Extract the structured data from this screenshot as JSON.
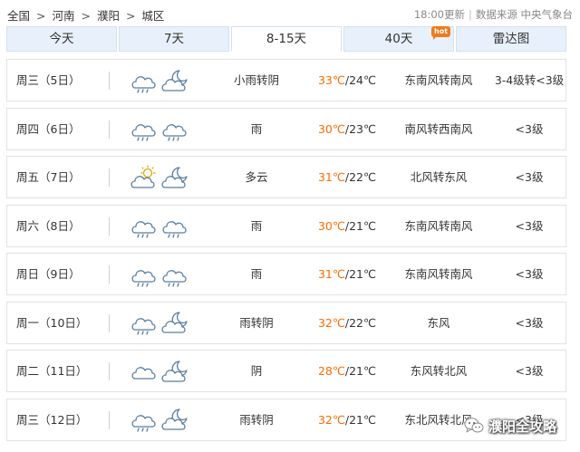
{
  "breadcrumb": {
    "items": [
      "全国",
      "河南",
      "濮阳",
      "城区"
    ],
    "separator": ">"
  },
  "update": {
    "time": "18:00更新",
    "source": "数据来源 中央气象台",
    "divider": "|"
  },
  "tabs": [
    {
      "label": "今天"
    },
    {
      "label": "7天"
    },
    {
      "label": "8-15天",
      "active": true
    },
    {
      "label": "40天",
      "badge": "hot"
    },
    {
      "label": "雷达图"
    }
  ],
  "temp_unit_sep": "/",
  "rows": [
    {
      "day": "周三（5日）",
      "icons": [
        "rain-cloud-icon",
        "moon-cloud-icon"
      ],
      "weather": "小雨转阴",
      "high": "33℃",
      "low": "24℃",
      "wind": "东南风转南风",
      "level": "3-4级转<3级"
    },
    {
      "day": "周四（6日）",
      "icons": [
        "rain-cloud-icon",
        "rain-cloud-icon"
      ],
      "weather": "雨",
      "high": "30℃",
      "low": "23℃",
      "wind": "南风转西南风",
      "level": "<3级"
    },
    {
      "day": "周五（7日）",
      "icons": [
        "sun-cloud-icon",
        "moon-cloud-icon"
      ],
      "weather": "多云",
      "high": "31℃",
      "low": "22℃",
      "wind": "北风转东风",
      "level": "<3级"
    },
    {
      "day": "周六（8日）",
      "icons": [
        "rain-cloud-icon",
        "rain-cloud-icon"
      ],
      "weather": "雨",
      "high": "30℃",
      "low": "21℃",
      "wind": "东南风转南风",
      "level": "<3级"
    },
    {
      "day": "周日（9日）",
      "icons": [
        "rain-cloud-icon",
        "rain-cloud-icon"
      ],
      "weather": "雨",
      "high": "31℃",
      "low": "21℃",
      "wind": "东南风转南风",
      "level": "<3级"
    },
    {
      "day": "周一（10日）",
      "icons": [
        "rain-cloud-icon",
        "moon-cloud-icon"
      ],
      "weather": "雨转阴",
      "high": "32℃",
      "low": "22℃",
      "wind": "东风",
      "level": "<3级"
    },
    {
      "day": "周二（11日）",
      "icons": [
        "cloud-icon",
        "moon-cloud-icon"
      ],
      "weather": "阴",
      "high": "28℃",
      "low": "21℃",
      "wind": "东风转北风",
      "level": "<3级"
    },
    {
      "day": "周三（12日）",
      "icons": [
        "rain-cloud-icon",
        "moon-cloud-icon"
      ],
      "weather": "雨转阴",
      "high": "32℃",
      "low": "21℃",
      "wind": "东北风转北风",
      "level": "<3级"
    }
  ],
  "watermark": {
    "label": "濮阳全攻略"
  }
}
